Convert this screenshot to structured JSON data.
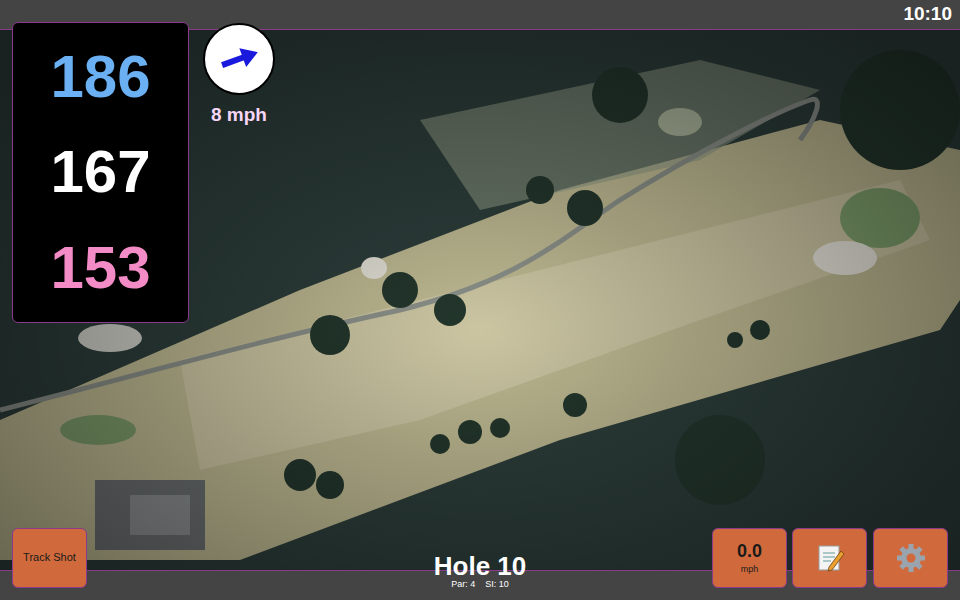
{
  "status_bar": {
    "clock": "10:10"
  },
  "distances": [
    {
      "value": "186",
      "color": "#6ab0f2"
    },
    {
      "value": "167",
      "color": "#ffffff"
    },
    {
      "value": "153",
      "color": "#f28bc6"
    }
  ],
  "wind": {
    "speed": "8 mph",
    "direction_deg": 70
  },
  "hole": {
    "title": "Hole 10",
    "par": "Par: 4",
    "si": "SI: 10"
  },
  "buttons": [
    {
      "kind": "track",
      "label": "Track Shot"
    },
    {
      "kind": "speed",
      "label": "0.0",
      "unit": "mph"
    },
    {
      "kind": "notes"
    },
    {
      "kind": "settings"
    }
  ]
}
